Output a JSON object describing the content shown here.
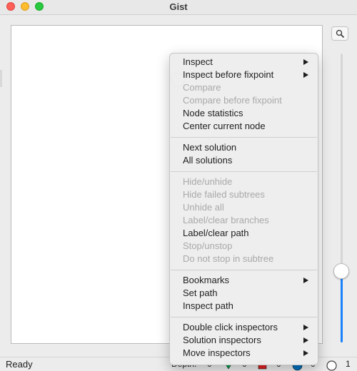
{
  "window": {
    "title": "Gist"
  },
  "menu": {
    "groups": [
      [
        {
          "label": "Inspect",
          "enabled": true,
          "submenu": true
        },
        {
          "label": "Inspect before fixpoint",
          "enabled": true,
          "submenu": true
        },
        {
          "label": "Compare",
          "enabled": false,
          "submenu": false
        },
        {
          "label": "Compare before fixpoint",
          "enabled": false,
          "submenu": false
        },
        {
          "label": "Node statistics",
          "enabled": true,
          "submenu": false
        },
        {
          "label": "Center current node",
          "enabled": true,
          "submenu": false
        }
      ],
      [
        {
          "label": "Next solution",
          "enabled": true,
          "submenu": false
        },
        {
          "label": "All solutions",
          "enabled": true,
          "submenu": false
        }
      ],
      [
        {
          "label": "Hide/unhide",
          "enabled": false,
          "submenu": false
        },
        {
          "label": "Hide failed subtrees",
          "enabled": false,
          "submenu": false
        },
        {
          "label": "Unhide all",
          "enabled": false,
          "submenu": false
        },
        {
          "label": "Label/clear branches",
          "enabled": false,
          "submenu": false
        },
        {
          "label": "Label/clear path",
          "enabled": true,
          "submenu": false
        },
        {
          "label": "Stop/unstop",
          "enabled": false,
          "submenu": false
        },
        {
          "label": "Do not stop in subtree",
          "enabled": false,
          "submenu": false
        }
      ],
      [
        {
          "label": "Bookmarks",
          "enabled": true,
          "submenu": true
        },
        {
          "label": "Set path",
          "enabled": true,
          "submenu": false
        },
        {
          "label": "Inspect path",
          "enabled": true,
          "submenu": false
        }
      ],
      [
        {
          "label": "Double click inspectors",
          "enabled": true,
          "submenu": true
        },
        {
          "label": "Solution inspectors",
          "enabled": true,
          "submenu": true
        },
        {
          "label": "Move inspectors",
          "enabled": true,
          "submenu": true
        }
      ]
    ]
  },
  "status": {
    "text": "Ready",
    "depth_label": "Depth:",
    "depth": "0",
    "solved": "0",
    "failed": "0",
    "choice": "0",
    "open": "1"
  },
  "colors": {
    "solved": "#00a651",
    "failed": "#e02020",
    "choice": "#0070c0",
    "accent": "#1a82fb"
  },
  "icons": {
    "zoom": "magnifier-icon",
    "root_node": "open-node-icon"
  }
}
